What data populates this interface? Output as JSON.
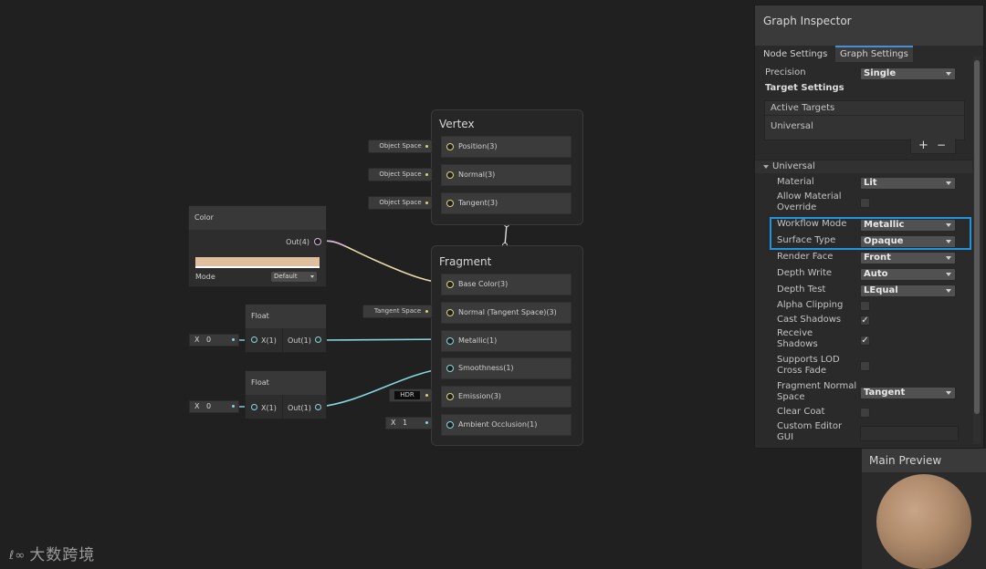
{
  "vertex": {
    "title": "Vertex",
    "ports": [
      {
        "label": "Position(3)",
        "input": "Object Space"
      },
      {
        "label": "Normal(3)",
        "input": "Object Space"
      },
      {
        "label": "Tangent(3)",
        "input": "Object Space"
      }
    ]
  },
  "fragment": {
    "title": "Fragment",
    "ports": [
      {
        "label": "Base Color(3)"
      },
      {
        "label": "Normal (Tangent Space)(3)",
        "input": "Tangent Space"
      },
      {
        "label": "Metallic(1)"
      },
      {
        "label": "Smoothness(1)"
      },
      {
        "label": "Emission(3)",
        "input": "HDR"
      },
      {
        "label": "Ambient Occlusion(1)",
        "input_x": "X",
        "input_v": "1"
      }
    ]
  },
  "color_node": {
    "title": "Color",
    "out": "Out(4)",
    "swatch": "#e0bea0",
    "mode_label": "Mode",
    "mode_value": "Default"
  },
  "float_nodes": [
    {
      "title": "Float",
      "x_label": "X",
      "x_value": "0",
      "in": "X(1)",
      "out": "Out(1)"
    },
    {
      "title": "Float",
      "x_label": "X",
      "x_value": "0",
      "in": "X(1)",
      "out": "Out(1)"
    }
  ],
  "inspector": {
    "title": "Graph Inspector",
    "tabs": [
      "Node Settings",
      "Graph Settings"
    ],
    "precision_label": "Precision",
    "precision_value": "Single",
    "target_settings": "Target Settings",
    "active_targets": "Active Targets",
    "target_item": "Universal",
    "add": "+",
    "remove": "−",
    "section": "Universal",
    "rows": [
      {
        "label": "Material",
        "value": "Lit"
      },
      {
        "label": "Allow Material Override"
      },
      {
        "label": "Workflow Mode",
        "value": "Metallic"
      },
      {
        "label": "Surface Type",
        "value": "Opaque"
      },
      {
        "label": "Render Face",
        "value": "Front"
      },
      {
        "label": "Depth Write",
        "value": "Auto"
      },
      {
        "label": "Depth Test",
        "value": "LEqual"
      },
      {
        "label": "Alpha Clipping"
      },
      {
        "label": "Cast Shadows",
        "check": "✓"
      },
      {
        "label": "Receive Shadows",
        "check": "✓"
      },
      {
        "label": "Supports LOD Cross Fade"
      },
      {
        "label": "Fragment Normal Space",
        "value": "Tangent"
      },
      {
        "label": "Clear Coat"
      },
      {
        "label": "Custom Editor GUI"
      }
    ]
  },
  "preview": {
    "title": "Main Preview"
  },
  "watermark": "大数跨境",
  "colors": {
    "accent": "#2196e0",
    "yellow_port": "#d8d47a",
    "cyan_port": "#87d6dc"
  }
}
